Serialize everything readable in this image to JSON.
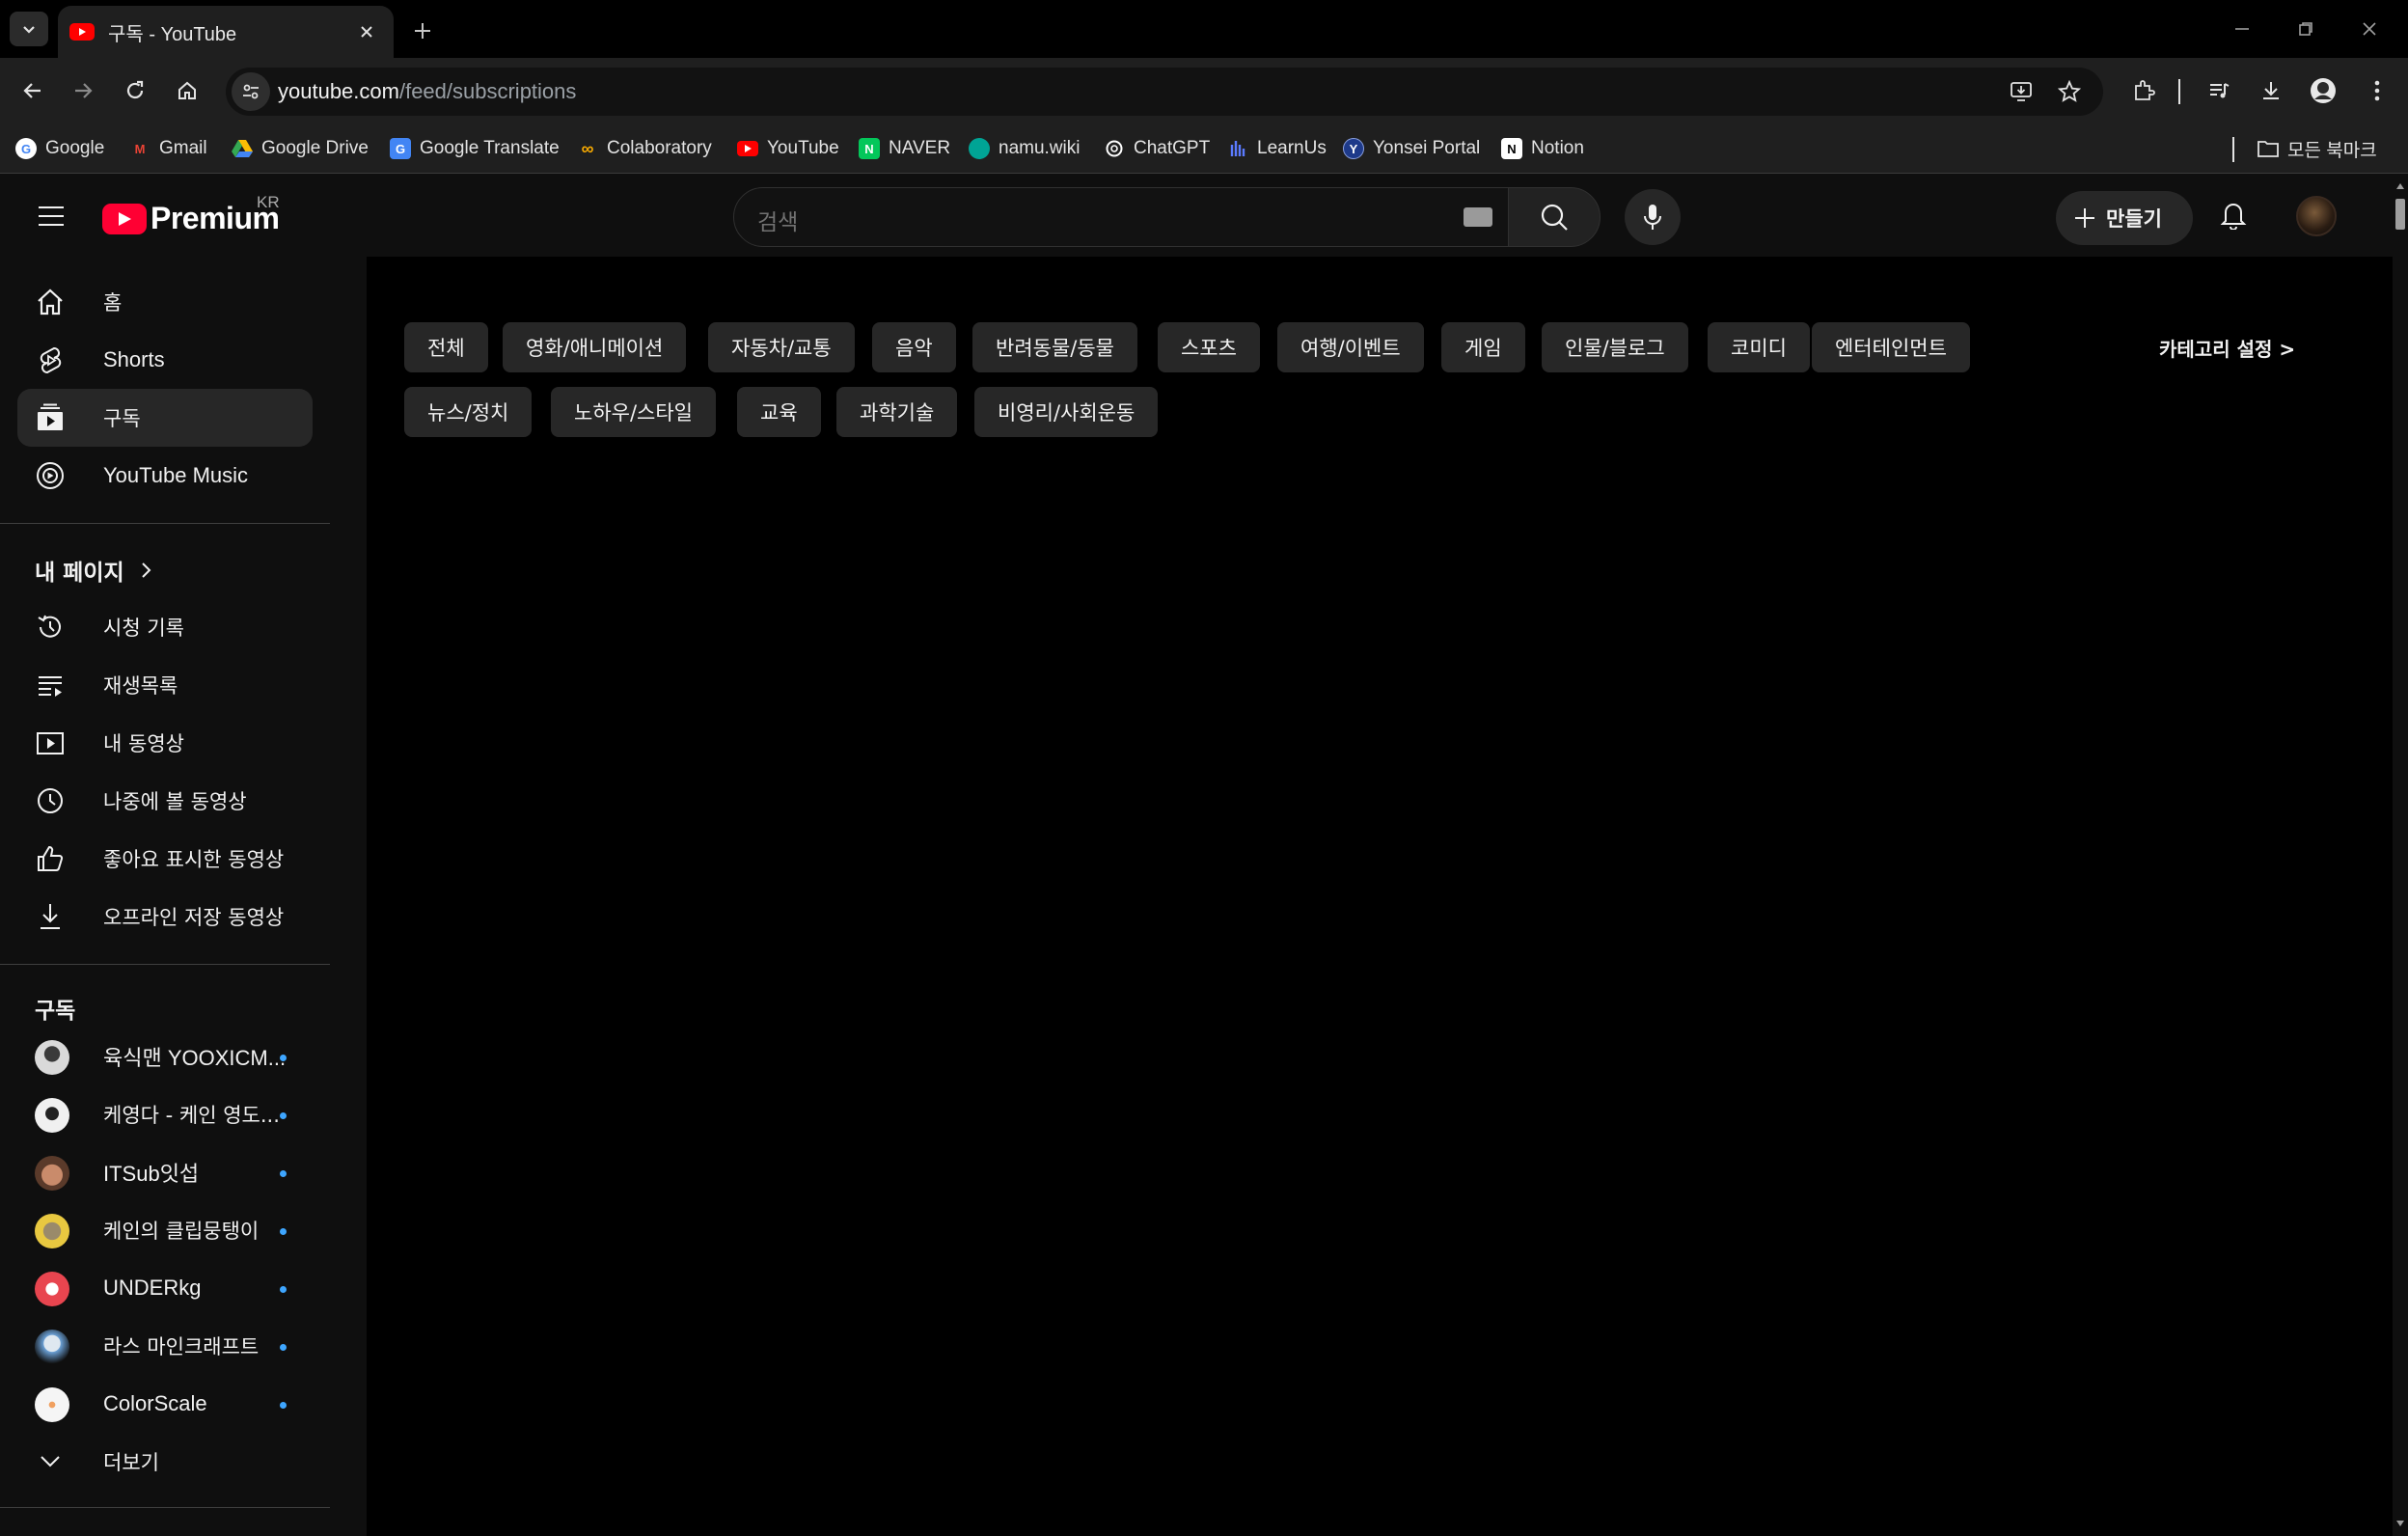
{
  "browser": {
    "tab_title": "구독 - YouTube",
    "url_host": "youtube.com",
    "url_path": "/feed/subscriptions",
    "bookmarks": [
      {
        "label": "Google",
        "icon": "google-icon",
        "color": "#4285f4"
      },
      {
        "label": "Gmail",
        "icon": "gmail-icon",
        "color": "#ea4335"
      },
      {
        "label": "Google Drive",
        "icon": "google-drive-icon",
        "color": "#34a853"
      },
      {
        "label": "Google Translate",
        "icon": "google-translate-icon",
        "color": "#4285f4"
      },
      {
        "label": "Colaboratory",
        "icon": "colab-icon",
        "color": "#f9ab00"
      },
      {
        "label": "YouTube",
        "icon": "youtube-icon",
        "color": "#ff0000"
      },
      {
        "label": "NAVER",
        "icon": "naver-icon",
        "color": "#03c75a"
      },
      {
        "label": "namu.wiki",
        "icon": "namuwiki-icon",
        "color": "#00a495"
      },
      {
        "label": "ChatGPT",
        "icon": "chatgpt-icon",
        "color": "#ffffff"
      },
      {
        "label": "LearnUs",
        "icon": "learnus-icon",
        "color": "#3b5bdb"
      },
      {
        "label": "Yonsei Portal",
        "icon": "yonsei-icon",
        "color": "#1e3a8a"
      },
      {
        "label": "Notion",
        "icon": "notion-icon",
        "color": "#ffffff"
      }
    ],
    "all_bookmarks": "모든 북마크"
  },
  "header": {
    "logo_text": "Premium",
    "country_code": "KR",
    "search_placeholder": "검색",
    "create_label": "만들기"
  },
  "sidebar": {
    "main_items": [
      {
        "label": "홈",
        "icon": "home-icon",
        "active": false
      },
      {
        "label": "Shorts",
        "icon": "shorts-icon",
        "active": false
      },
      {
        "label": "구독",
        "icon": "subscriptions-icon",
        "active": true
      },
      {
        "label": "YouTube Music",
        "icon": "youtube-music-icon",
        "active": false
      }
    ],
    "you_heading": "내 페이지",
    "you_items": [
      {
        "label": "시청 기록",
        "icon": "history-icon"
      },
      {
        "label": "재생목록",
        "icon": "playlists-icon"
      },
      {
        "label": "내 동영상",
        "icon": "your-videos-icon"
      },
      {
        "label": "나중에 볼 동영상",
        "icon": "watch-later-icon"
      },
      {
        "label": "좋아요 표시한 동영상",
        "icon": "liked-videos-icon"
      },
      {
        "label": "오프라인 저장 동영상",
        "icon": "downloads-icon"
      }
    ],
    "subs_heading": "구독",
    "subscriptions": [
      {
        "label": "육식맨 YOOXICM...",
        "color": "#d9d9d9"
      },
      {
        "label": "케영다 - 케인 영도...",
        "color": "#f0f0f0"
      },
      {
        "label": "ITSub잇섭",
        "color": "#c98b6b"
      },
      {
        "label": "케인의 클립뭉탱이",
        "color": "#e8c840"
      },
      {
        "label": "UNDERkg",
        "color": "#e8454f"
      },
      {
        "label": "라스 마인크래프트",
        "color": "#6a9fd4"
      },
      {
        "label": "ColorScale",
        "color": "#f5f5f5"
      }
    ],
    "more_label": "더보기"
  },
  "main": {
    "chips_row1": [
      "전체",
      "영화/애니메이션",
      "자동차/교통",
      "음악",
      "반려동물/동물",
      "스포츠",
      "여행/이벤트",
      "게임",
      "인물/블로그",
      "코미디",
      "엔터테인먼트"
    ],
    "chips_row2": [
      "뉴스/정치",
      "노하우/스타일",
      "교육",
      "과학기술",
      "비영리/사회운동"
    ],
    "category_settings": "카테고리 설정 >"
  },
  "colors": {
    "accent_red": "#ff0033",
    "subscription_dot": "#3ea6ff",
    "chip_bg": "#272727"
  }
}
